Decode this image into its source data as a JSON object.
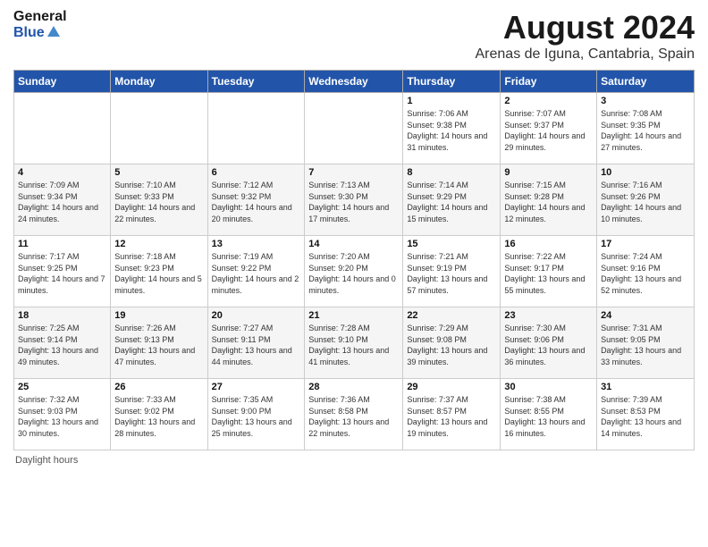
{
  "header": {
    "logo_general": "General",
    "logo_blue": "Blue",
    "title": "August 2024",
    "subtitle": "Arenas de Iguna, Cantabria, Spain"
  },
  "calendar": {
    "days_of_week": [
      "Sunday",
      "Monday",
      "Tuesday",
      "Wednesday",
      "Thursday",
      "Friday",
      "Saturday"
    ],
    "weeks": [
      [
        {
          "day": "",
          "info": ""
        },
        {
          "day": "",
          "info": ""
        },
        {
          "day": "",
          "info": ""
        },
        {
          "day": "",
          "info": ""
        },
        {
          "day": "1",
          "info": "Sunrise: 7:06 AM\nSunset: 9:38 PM\nDaylight: 14 hours and 31 minutes."
        },
        {
          "day": "2",
          "info": "Sunrise: 7:07 AM\nSunset: 9:37 PM\nDaylight: 14 hours and 29 minutes."
        },
        {
          "day": "3",
          "info": "Sunrise: 7:08 AM\nSunset: 9:35 PM\nDaylight: 14 hours and 27 minutes."
        }
      ],
      [
        {
          "day": "4",
          "info": "Sunrise: 7:09 AM\nSunset: 9:34 PM\nDaylight: 14 hours and 24 minutes."
        },
        {
          "day": "5",
          "info": "Sunrise: 7:10 AM\nSunset: 9:33 PM\nDaylight: 14 hours and 22 minutes."
        },
        {
          "day": "6",
          "info": "Sunrise: 7:12 AM\nSunset: 9:32 PM\nDaylight: 14 hours and 20 minutes."
        },
        {
          "day": "7",
          "info": "Sunrise: 7:13 AM\nSunset: 9:30 PM\nDaylight: 14 hours and 17 minutes."
        },
        {
          "day": "8",
          "info": "Sunrise: 7:14 AM\nSunset: 9:29 PM\nDaylight: 14 hours and 15 minutes."
        },
        {
          "day": "9",
          "info": "Sunrise: 7:15 AM\nSunset: 9:28 PM\nDaylight: 14 hours and 12 minutes."
        },
        {
          "day": "10",
          "info": "Sunrise: 7:16 AM\nSunset: 9:26 PM\nDaylight: 14 hours and 10 minutes."
        }
      ],
      [
        {
          "day": "11",
          "info": "Sunrise: 7:17 AM\nSunset: 9:25 PM\nDaylight: 14 hours and 7 minutes."
        },
        {
          "day": "12",
          "info": "Sunrise: 7:18 AM\nSunset: 9:23 PM\nDaylight: 14 hours and 5 minutes."
        },
        {
          "day": "13",
          "info": "Sunrise: 7:19 AM\nSunset: 9:22 PM\nDaylight: 14 hours and 2 minutes."
        },
        {
          "day": "14",
          "info": "Sunrise: 7:20 AM\nSunset: 9:20 PM\nDaylight: 14 hours and 0 minutes."
        },
        {
          "day": "15",
          "info": "Sunrise: 7:21 AM\nSunset: 9:19 PM\nDaylight: 13 hours and 57 minutes."
        },
        {
          "day": "16",
          "info": "Sunrise: 7:22 AM\nSunset: 9:17 PM\nDaylight: 13 hours and 55 minutes."
        },
        {
          "day": "17",
          "info": "Sunrise: 7:24 AM\nSunset: 9:16 PM\nDaylight: 13 hours and 52 minutes."
        }
      ],
      [
        {
          "day": "18",
          "info": "Sunrise: 7:25 AM\nSunset: 9:14 PM\nDaylight: 13 hours and 49 minutes."
        },
        {
          "day": "19",
          "info": "Sunrise: 7:26 AM\nSunset: 9:13 PM\nDaylight: 13 hours and 47 minutes."
        },
        {
          "day": "20",
          "info": "Sunrise: 7:27 AM\nSunset: 9:11 PM\nDaylight: 13 hours and 44 minutes."
        },
        {
          "day": "21",
          "info": "Sunrise: 7:28 AM\nSunset: 9:10 PM\nDaylight: 13 hours and 41 minutes."
        },
        {
          "day": "22",
          "info": "Sunrise: 7:29 AM\nSunset: 9:08 PM\nDaylight: 13 hours and 39 minutes."
        },
        {
          "day": "23",
          "info": "Sunrise: 7:30 AM\nSunset: 9:06 PM\nDaylight: 13 hours and 36 minutes."
        },
        {
          "day": "24",
          "info": "Sunrise: 7:31 AM\nSunset: 9:05 PM\nDaylight: 13 hours and 33 minutes."
        }
      ],
      [
        {
          "day": "25",
          "info": "Sunrise: 7:32 AM\nSunset: 9:03 PM\nDaylight: 13 hours and 30 minutes."
        },
        {
          "day": "26",
          "info": "Sunrise: 7:33 AM\nSunset: 9:02 PM\nDaylight: 13 hours and 28 minutes."
        },
        {
          "day": "27",
          "info": "Sunrise: 7:35 AM\nSunset: 9:00 PM\nDaylight: 13 hours and 25 minutes."
        },
        {
          "day": "28",
          "info": "Sunrise: 7:36 AM\nSunset: 8:58 PM\nDaylight: 13 hours and 22 minutes."
        },
        {
          "day": "29",
          "info": "Sunrise: 7:37 AM\nSunset: 8:57 PM\nDaylight: 13 hours and 19 minutes."
        },
        {
          "day": "30",
          "info": "Sunrise: 7:38 AM\nSunset: 8:55 PM\nDaylight: 13 hours and 16 minutes."
        },
        {
          "day": "31",
          "info": "Sunrise: 7:39 AM\nSunset: 8:53 PM\nDaylight: 13 hours and 14 minutes."
        }
      ]
    ]
  },
  "footer": {
    "text": "Daylight hours"
  }
}
